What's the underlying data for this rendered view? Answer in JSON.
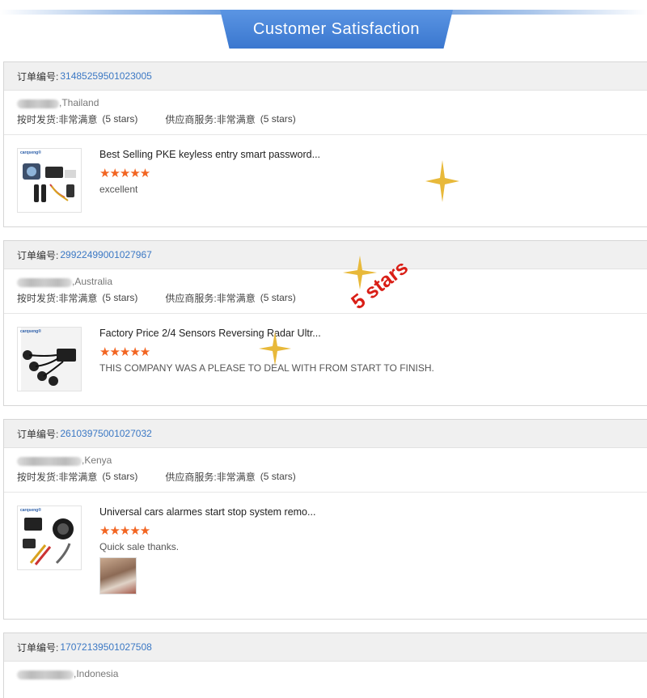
{
  "header": {
    "title": "Customer Satisfaction"
  },
  "labels": {
    "order_no": "订单编号:",
    "ship_label": "按时发货: ",
    "supplier_label": "供应商服务: ",
    "very_satisfied": "非常满意",
    "five_stars": "(5 stars)",
    "stars_glyph": "★★★★★"
  },
  "orders": [
    {
      "order_number": "31485259501023005",
      "country": ",Thailand",
      "product_title": "Best Selling PKE keyless entry smart password...",
      "review": "excellent"
    },
    {
      "order_number": "29922499001027967",
      "country": ",Australia",
      "product_title": "Factory Price 2/4 Sensors Reversing Radar Ultr...",
      "review": "THIS COMPANY WAS A PLEASE TO DEAL WITH FROM START TO FINISH."
    },
    {
      "order_number": "26103975001027032",
      "country": ",Kenya",
      "product_title": "Universal cars alarmes start stop system remo...",
      "review": "Quick sale thanks."
    },
    {
      "order_number": "17072139501027508",
      "country": ",Indonesia"
    }
  ],
  "thumb_brand": "carqseng®",
  "overlay": {
    "badge": "5 stars"
  },
  "colors": {
    "accent": "#3a77cf",
    "link": "#3b78c4",
    "star": "#f26522",
    "badge": "#d91e16",
    "sparkle": "#e8b93a"
  }
}
